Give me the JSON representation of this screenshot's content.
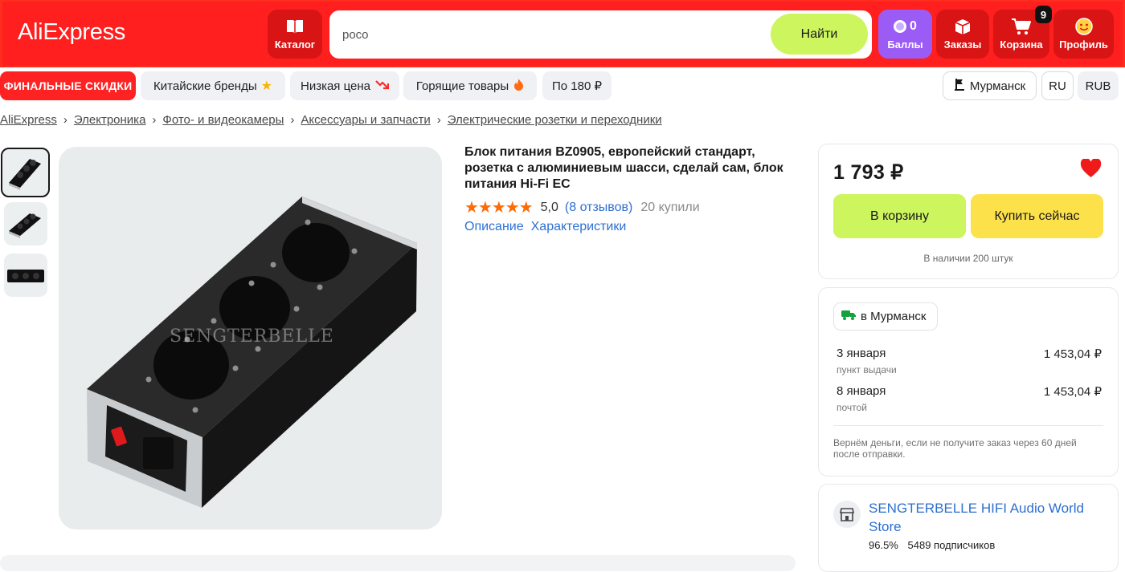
{
  "header": {
    "logo": "AliExpress",
    "catalog_label": "Каталог",
    "search_value": "poco",
    "search_button": "Найти",
    "points_value": "0",
    "points_label": "Баллы",
    "orders_label": "Заказы",
    "cart_label": "Корзина",
    "cart_count": "9",
    "profile_label": "Профиль"
  },
  "subnav": {
    "promo": "ФИНАЛЬНЫЕ СКИДКИ",
    "chips": [
      "Китайские бренды",
      "Низкая цена",
      "Горящие товары",
      "По 180 ₽"
    ],
    "location": "Мурманск",
    "language": "RU",
    "currency": "RUB"
  },
  "breadcrumbs": [
    "AliExpress",
    "Электроника",
    "Фото- и видеокамеры",
    "Аксессуары и запчасти",
    "Электрические розетки и переходники"
  ],
  "product": {
    "title": "Блок питания BZ0905, европейский стандарт, розетка с алюминиевым шасси, сделай сам, блок питания Hi-Fi EC",
    "rating": "5,0",
    "reviews": "(8 отзывов)",
    "sold": "20 купили",
    "tab_description": "Описание",
    "tab_specs": "Характеристики",
    "watermark": "SENGTERBELLE"
  },
  "buybox": {
    "price": "1 793 ₽",
    "add_to_cart": "В корзину",
    "buy_now": "Купить сейчас",
    "stock": "В наличии 200 штук"
  },
  "delivery": {
    "city": "в Мурманск",
    "options": [
      {
        "date": "3 января",
        "method": "пункт выдачи",
        "price": "1 453,04 ₽"
      },
      {
        "date": "8 января",
        "method": "почтой",
        "price": "1 453,04 ₽"
      }
    ],
    "refund_note": "Вернём деньги, если не получите заказ через 60 дней после отправки."
  },
  "store": {
    "name": "SENGTERBELLE HIFI Audio World Store",
    "rating": "96.5%",
    "followers": "5489 подписчиков"
  },
  "colors": {
    "brand_red": "#ff1f1f",
    "search_button": "#cdf55e",
    "cart_button": "#cdf55e",
    "buy_button": "#fde14b",
    "points_tile": "#9b5cf6",
    "link_blue": "#2d6fd2",
    "star_orange": "#fd6b05"
  }
}
